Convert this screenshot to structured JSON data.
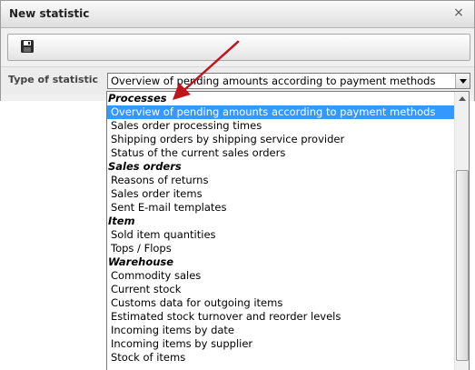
{
  "dialog": {
    "title": "New statistic",
    "close_glyph": "×",
    "toolbar": {
      "save_icon": "floppy-disk-icon"
    },
    "type_label": "Type of statistic",
    "selected_value": "Overview of pending amounts according to payment methods"
  },
  "list": {
    "items": [
      {
        "text": "Processes",
        "kind": "group"
      },
      {
        "text": "Overview of pending amounts according to payment methods",
        "kind": "option",
        "selected": true
      },
      {
        "text": "Sales order processing times",
        "kind": "option"
      },
      {
        "text": "Shipping orders by shipping service provider",
        "kind": "option"
      },
      {
        "text": "Status of the current sales orders",
        "kind": "option"
      },
      {
        "text": "Sales orders",
        "kind": "group"
      },
      {
        "text": "Reasons of returns",
        "kind": "option"
      },
      {
        "text": "Sales order items",
        "kind": "option"
      },
      {
        "text": "Sent E-mail templates",
        "kind": "option"
      },
      {
        "text": "Item",
        "kind": "group"
      },
      {
        "text": "Sold item quantities",
        "kind": "option"
      },
      {
        "text": "Tops / Flops",
        "kind": "option"
      },
      {
        "text": "Warehouse",
        "kind": "group"
      },
      {
        "text": "Commodity sales",
        "kind": "option"
      },
      {
        "text": "Current stock",
        "kind": "option"
      },
      {
        "text": "Customs data for outgoing items",
        "kind": "option"
      },
      {
        "text": "Estimated stock turnover and reorder levels",
        "kind": "option"
      },
      {
        "text": "Incoming items by date",
        "kind": "option"
      },
      {
        "text": "Incoming items by supplier",
        "kind": "option"
      },
      {
        "text": "Stock of items",
        "kind": "option"
      }
    ]
  },
  "colors": {
    "selection": "#3399ff",
    "annotation_arrow": "#c0141c"
  }
}
